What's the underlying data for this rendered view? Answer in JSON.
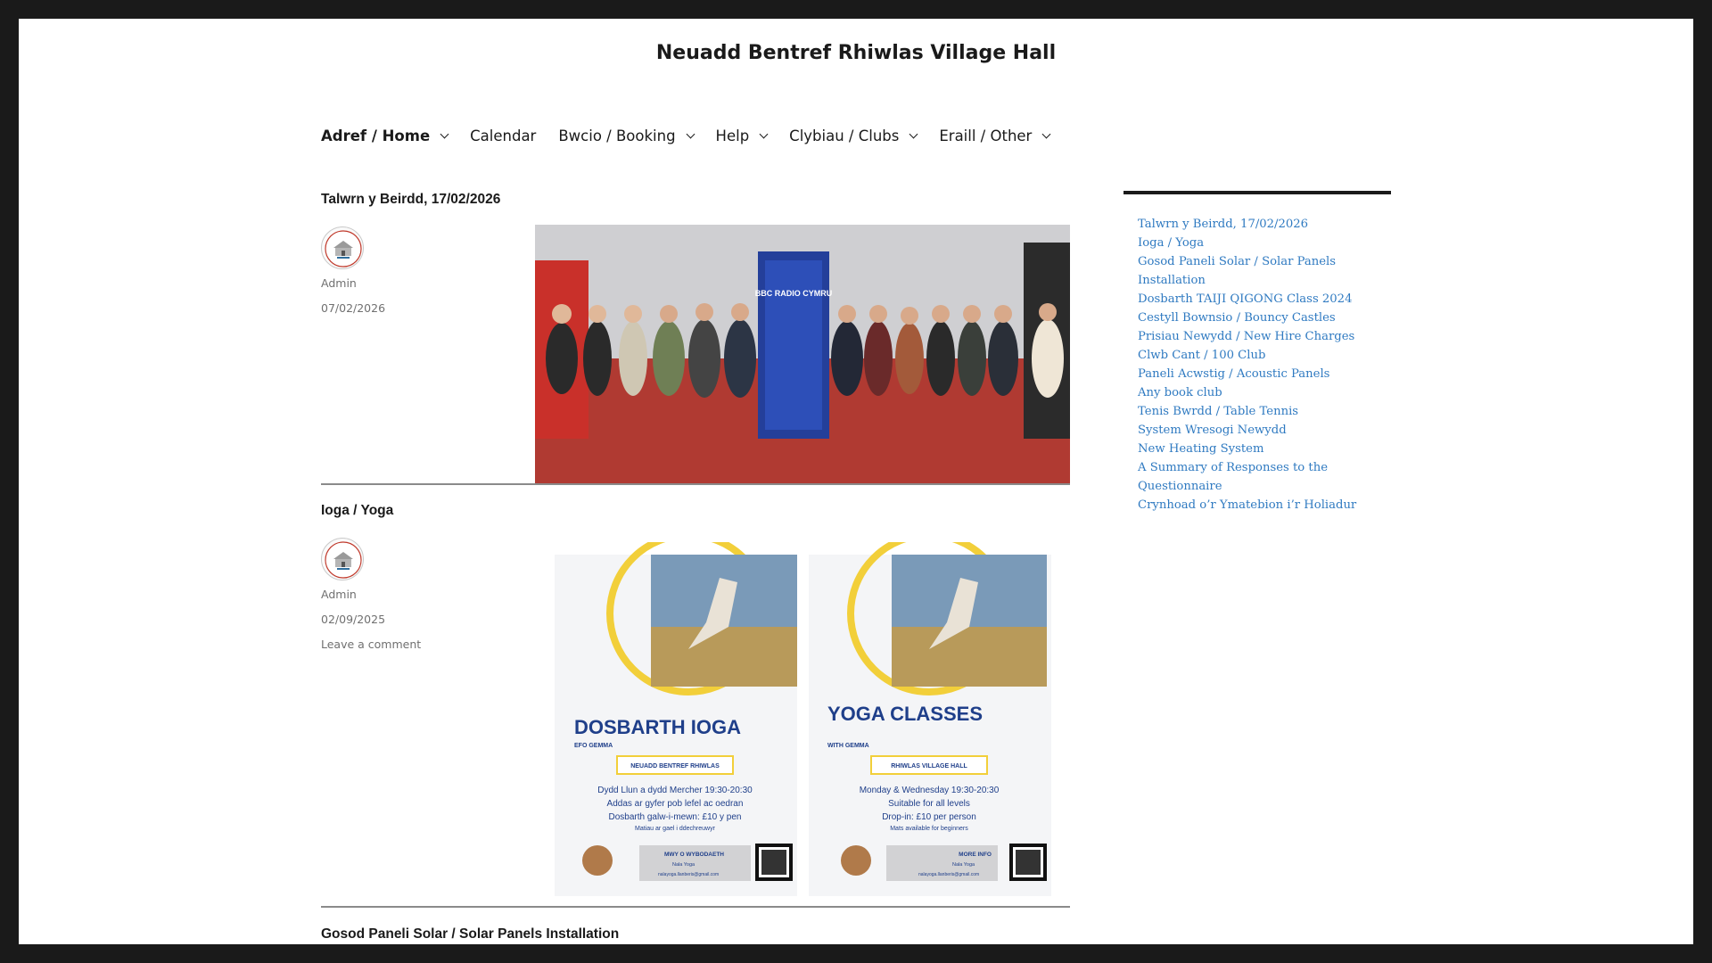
{
  "site": {
    "title": "Neuadd Bentref Rhiwlas Village Hall"
  },
  "nav": {
    "items": [
      {
        "label": "Adref / Home",
        "has_dropdown": true,
        "active": true
      },
      {
        "label": "Calendar",
        "has_dropdown": false,
        "active": false
      },
      {
        "label": "Bwcio / Booking",
        "has_dropdown": true,
        "active": false
      },
      {
        "label": "Help",
        "has_dropdown": true,
        "active": false
      },
      {
        "label": "Clybiau / Clubs",
        "has_dropdown": true,
        "active": false
      },
      {
        "label": "Eraill / Other",
        "has_dropdown": true,
        "active": false
      }
    ]
  },
  "posts": [
    {
      "title": "Talwrn y Beirdd, 17/02/2026",
      "author": "Admin",
      "date": "07/02/2026",
      "image_banner_text": "BBC RADIO CYMRU"
    },
    {
      "title": "Ioga / Yoga",
      "author": "Admin",
      "date": "02/09/2025",
      "comment_link": "Leave a comment"
    },
    {
      "title": "Gosod Paneli Solar / Solar Panels Installation"
    }
  ],
  "flyer": {
    "left": {
      "heading": "DOSBARTH IOGA",
      "sub": "EFO GEMMA",
      "venue": "NEUADD BENTREF RHIWLAS",
      "lines": [
        "Dydd Llun a dydd Mercher 19:30-20:30",
        "Addas ar gyfer pob lefel ac oedran",
        "Dosbarth galw-i-mewn: £10 y pen"
      ],
      "note": "Matiau ar gael i ddechreuwyr",
      "info_label": "MWY O WYBODAETH",
      "contact_fb": "Nala Yoga",
      "contact_email": "nalayoga.llanberis@gmail.com"
    },
    "right": {
      "heading": "YOGA CLASSES",
      "sub": "WITH GEMMA",
      "venue": "RHIWLAS VILLAGE HALL",
      "lines": [
        "Monday & Wednesday 19:30-20:30",
        "Suitable for all levels",
        "Drop-in: £10 per person"
      ],
      "note": "Mats available for beginners",
      "info_label": "MORE INFO",
      "contact_fb": "Nala Yoga",
      "contact_email": "nalayoga.llanberis@gmail.com"
    }
  },
  "sidebar": {
    "recent_posts": [
      "Talwrn y Beirdd, 17/02/2026",
      "Ioga / Yoga",
      "Gosod Paneli Solar / Solar Panels Installation",
      "Dosbarth TAIJI QIGONG Class 2024",
      "Cestyll Bownsio / Bouncy Castles",
      "Prisiau Newydd / New Hire Charges",
      "Clwb Cant / 100 Club",
      "Paneli Acwstig / Acoustic Panels",
      "Any book club",
      "Tenis Bwrdd / Table Tennis",
      "System Wresogi Newydd",
      "New Heating System",
      "A Summary of Responses to the Questionnaire",
      "Crynhoad o’r Ymatebion i’r Holiadur"
    ]
  },
  "colors": {
    "link": "#2f7ac1",
    "text": "#1a1a1a",
    "meta": "#707070",
    "frame": "#1a1a1a"
  }
}
